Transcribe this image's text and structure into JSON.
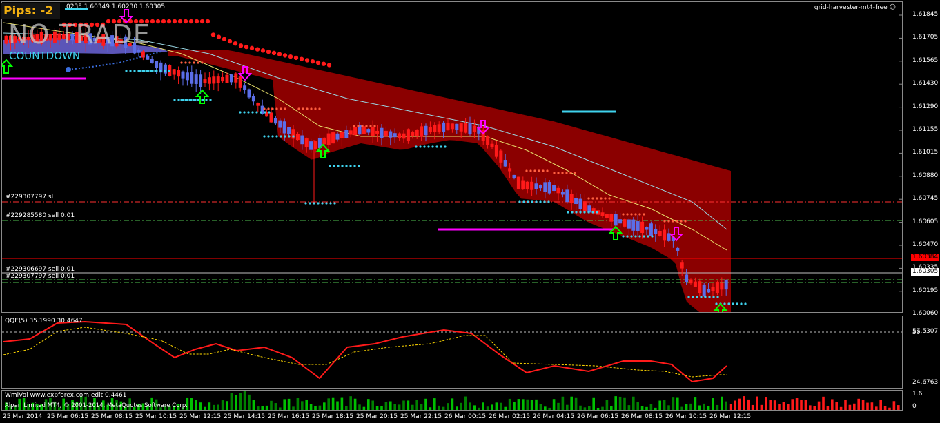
{
  "header": {
    "pips_label": "Pips:  -2",
    "ohlc_text": "0235 1.60349 1.60230 1.60305",
    "status": "NO TRADE",
    "countdown": "COUNTDOWN",
    "indicator_name": "grid-harvester-mt4-free"
  },
  "price_axis": [
    "1.61845",
    "1.61705",
    "1.61565",
    "1.61430",
    "1.61290",
    "1.61155",
    "1.61015",
    "1.60880",
    "1.60745",
    "1.60605",
    "1.60470",
    "1.60335",
    "1.60195",
    "1.60060"
  ],
  "price_boxes": {
    "red": "1.60384",
    "white": "1.60305"
  },
  "trade_lines": [
    "#229307797 sl",
    "#229285580 sell 0.01",
    "#229306697 sell 0.01",
    "#229307797 sell 0.01"
  ],
  "qqe": {
    "title": "QQE(5) 35.1990 30.4647",
    "levels": [
      "57.5307",
      "50",
      "24.6763"
    ]
  },
  "volume": {
    "title": "WmiVol www.expforex.com edit 0.4461",
    "levels": [
      "1.6",
      "0"
    ]
  },
  "copyright": "Alpari Limited MT4, © 2001-2014, MetaQuotes Software Corp.",
  "time_axis": [
    "25 Mar 2014",
    "25 Mar 06:15",
    "25 Mar 08:15",
    "25 Mar 10:15",
    "25 Mar 12:15",
    "25 Mar 14:15",
    "25 Mar 16:15",
    "25 Mar 18:15",
    "25 Mar 20:15",
    "25 Mar 22:15",
    "26 Mar 00:15",
    "26 Mar 02:15",
    "26 Mar 04:15",
    "26 Mar 06:15",
    "26 Mar 08:15",
    "26 Mar 10:15",
    "26 Mar 12:15"
  ],
  "colors": {
    "bull": "#5b6ee8",
    "bear": "#ff1a1a",
    "cloud": "#8b0000",
    "up_arrow": "#00ff00",
    "down_arrow": "#ff00ff",
    "cyan": "#3fd3ee",
    "pips": "#f2b010"
  }
}
